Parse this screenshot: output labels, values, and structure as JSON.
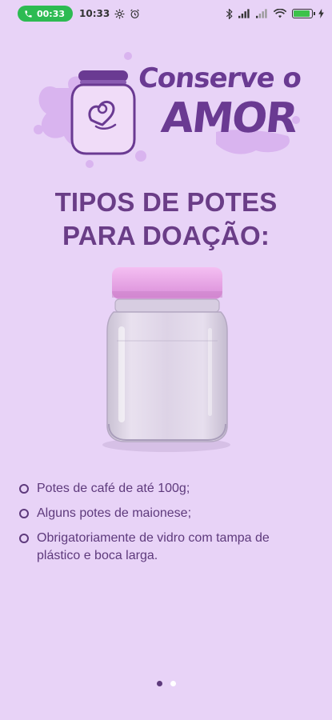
{
  "status_bar": {
    "call_duration": "00:33",
    "time": "10:33",
    "battery_level": 0.9,
    "icons": [
      "phone-icon",
      "settings-gear-icon",
      "alarm-icon",
      "bluetooth-icon",
      "signal-icon",
      "signal-icon",
      "wifi-icon",
      "battery-icon",
      "charging-icon"
    ]
  },
  "logo": {
    "line1": "Conserve o",
    "line2": "AMOR"
  },
  "title": {
    "line1": "TIPOS DE POTES",
    "line2": "PARA DOAÇÃO:"
  },
  "list": {
    "items": [
      "Potes de café de até 100g;",
      "Alguns potes de maionese;",
      "Obrigatoriamente de vidro com tampa de plástico e boca larga."
    ]
  },
  "pager": {
    "total": 2,
    "current": 1
  },
  "colors": {
    "background": "#e8d3f7",
    "primary": "#6a3d87",
    "jar_lid": "#e8a6e6",
    "call_pill": "#2dbb52"
  }
}
